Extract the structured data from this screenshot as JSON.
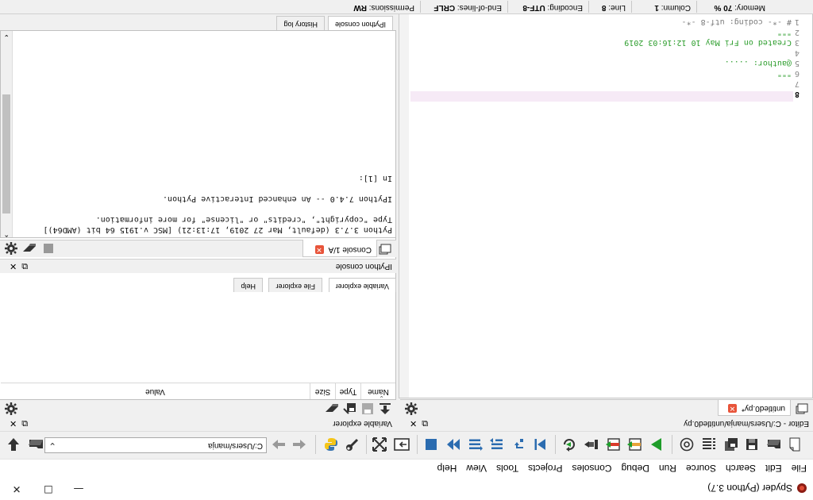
{
  "window": {
    "title": "Spyder (Python 3.7)",
    "minimize": "—",
    "maximize": "☐",
    "close": "✕"
  },
  "menu": [
    "File",
    "Edit",
    "Search",
    "Source",
    "Run",
    "Debug",
    "Consoles",
    "Projects",
    "Tools",
    "View",
    "Help"
  ],
  "toolbar": {
    "path_value": "C:/Users/manja"
  },
  "editor": {
    "header": "Editor - C:/Users/manja/untitled0.py",
    "tab_label": "untitled0.py*",
    "lines": [
      {
        "n": "1",
        "text": "# -*- coding: utf-8 -*-",
        "cls": "grey"
      },
      {
        "n": "2",
        "text": "\"\"\"",
        "cls": "green"
      },
      {
        "n": "3",
        "text": "Created on Fri May 10 12:16:03 2019",
        "cls": "green"
      },
      {
        "n": "4",
        "text": "",
        "cls": "green"
      },
      {
        "n": "5",
        "text": "@author: .....",
        "cls": "green"
      },
      {
        "n": "6",
        "text": "\"\"\"",
        "cls": "green"
      },
      {
        "n": "7",
        "text": "",
        "cls": ""
      },
      {
        "n": "8",
        "text": "",
        "cls": ""
      }
    ]
  },
  "variable_explorer": {
    "header": "Variable explorer",
    "columns": [
      "Name",
      "Type",
      "Size",
      "Value"
    ],
    "tabs": [
      "Variable explorer",
      "File explorer",
      "Help"
    ]
  },
  "console": {
    "header": "IPython console",
    "tab_label": "Console 1/A",
    "lines": [
      "Python 3.7.3 (default, Mar 27 2019, 17:13:21) [MSC v.1915 64 bit (AMD64)]",
      "Type \"copyright\", \"credits\" or \"license\" for more information.",
      "",
      "IPython 7.4.0 -- An enhanced Interactive Python.",
      "",
      "In [1]:"
    ],
    "bottom_tabs": [
      "IPython console",
      "History log"
    ]
  },
  "status": {
    "permissions_label": "Permissions:",
    "permissions_value": "RW",
    "eol_label": "End-of-lines:",
    "eol_value": "CRLF",
    "encoding_label": "Encoding:",
    "encoding_value": "UTF-8",
    "line_label": "Line:",
    "line_value": "8",
    "column_label": "Column:",
    "column_value": "1",
    "memory_label": "Memory:",
    "memory_value": "70 %"
  },
  "colors": {
    "run_green": "#1f9d2a",
    "close_red": "#e8543a",
    "string_green": "#2e9e2e",
    "current_line": "#f6eaf6",
    "stop_blue": "#2b6cb0"
  }
}
